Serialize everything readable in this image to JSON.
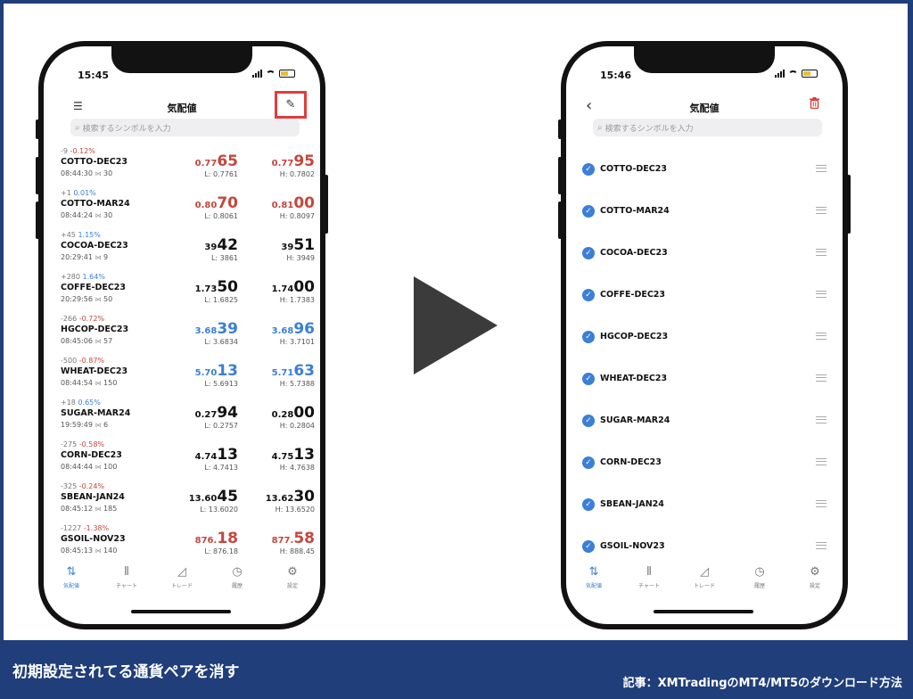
{
  "left_phone": {
    "status_time": "15:45",
    "title": "気配値",
    "search_placeholder": "検索するシンボルを入力",
    "quotes": [
      {
        "change_pts": "-9",
        "change_pct": "-0.12%",
        "dir": "down",
        "symbol": "COTTO-DEC23",
        "time": "08:44:30",
        "spread": "30",
        "bid_prefix": "0.77",
        "bid_big": "65",
        "ask_prefix": "0.77",
        "ask_big": "95",
        "bid_color": "red",
        "low": "L: 0.7761",
        "high": "H: 0.7802"
      },
      {
        "change_pts": "+1",
        "change_pct": "0.01%",
        "dir": "up",
        "symbol": "COTTO-MAR24",
        "time": "08:44:24",
        "spread": "30",
        "bid_prefix": "0.80",
        "bid_big": "70",
        "ask_prefix": "0.81",
        "ask_big": "00",
        "bid_color": "red",
        "low": "L: 0.8061",
        "high": "H: 0.8097"
      },
      {
        "change_pts": "+45",
        "change_pct": "1.15%",
        "dir": "up",
        "symbol": "COCOA-DEC23",
        "time": "20:29:41",
        "spread": "9",
        "bid_prefix": "39",
        "bid_big": "42",
        "ask_prefix": "39",
        "ask_big": "51",
        "bid_color": "blk",
        "low": "L: 3861",
        "high": "H: 3949"
      },
      {
        "change_pts": "+280",
        "change_pct": "1.64%",
        "dir": "up",
        "symbol": "COFFE-DEC23",
        "time": "20:29:56",
        "spread": "50",
        "bid_prefix": "1.73",
        "bid_big": "50",
        "ask_prefix": "1.74",
        "ask_big": "00",
        "bid_color": "blk",
        "low": "L: 1.6825",
        "high": "H: 1.7383"
      },
      {
        "change_pts": "-266",
        "change_pct": "-0.72%",
        "dir": "down",
        "symbol": "HGCOP-DEC23",
        "time": "08:45:06",
        "spread": "57",
        "bid_prefix": "3.68",
        "bid_big": "39",
        "ask_prefix": "3.68",
        "ask_big": "96",
        "bid_color": "blue",
        "low": "L: 3.6834",
        "high": "H: 3.7101"
      },
      {
        "change_pts": "-500",
        "change_pct": "-0.87%",
        "dir": "down",
        "symbol": "WHEAT-DEC23",
        "time": "08:44:54",
        "spread": "150",
        "bid_prefix": "5.70",
        "bid_big": "13",
        "ask_prefix": "5.71",
        "ask_big": "63",
        "bid_color": "blue",
        "low": "L: 5.6913",
        "high": "H: 5.7388"
      },
      {
        "change_pts": "+18",
        "change_pct": "0.65%",
        "dir": "up",
        "symbol": "SUGAR-MAR24",
        "time": "19:59:49",
        "spread": "6",
        "bid_prefix": "0.27",
        "bid_big": "94",
        "ask_prefix": "0.28",
        "ask_big": "00",
        "bid_color": "blk",
        "low": "L: 0.2757",
        "high": "H: 0.2804"
      },
      {
        "change_pts": "-275",
        "change_pct": "-0.58%",
        "dir": "down",
        "symbol": "CORN-DEC23",
        "time": "08:44:44",
        "spread": "100",
        "bid_prefix": "4.74",
        "bid_big": "13",
        "ask_prefix": "4.75",
        "ask_big": "13",
        "bid_color": "blk",
        "low": "L: 4.7413",
        "high": "H: 4.7638"
      },
      {
        "change_pts": "-325",
        "change_pct": "-0.24%",
        "dir": "down",
        "symbol": "SBEAN-JAN24",
        "time": "08:45:12",
        "spread": "185",
        "bid_prefix": "13.60",
        "bid_big": "45",
        "ask_prefix": "13.62",
        "ask_big": "30",
        "bid_color": "blk",
        "low": "L: 13.6020",
        "high": "H: 13.6520"
      },
      {
        "change_pts": "-1227",
        "change_pct": "-1.38%",
        "dir": "down",
        "symbol": "GSOIL-NOV23",
        "time": "08:45:13",
        "spread": "140",
        "bid_prefix": "876.",
        "bid_big": "18",
        "ask_prefix": "877.",
        "ask_big": "58",
        "bid_color": "red",
        "low": "L: 876.18",
        "high": "H: 888.45"
      }
    ]
  },
  "right_phone": {
    "status_time": "15:46",
    "title": "気配値",
    "search_placeholder": "検索するシンボルを入力",
    "symbols": [
      "COTTO-DEC23",
      "COTTO-MAR24",
      "COCOA-DEC23",
      "COFFE-DEC23",
      "HGCOP-DEC23",
      "WHEAT-DEC23",
      "SUGAR-MAR24",
      "CORN-DEC23",
      "SBEAN-JAN24",
      "GSOIL-NOV23"
    ]
  },
  "tabs": [
    {
      "label": "気配値",
      "icon": "swap-arrows-icon"
    },
    {
      "label": "チャート",
      "icon": "candlestick-icon"
    },
    {
      "label": "トレード",
      "icon": "trade-chart-icon"
    },
    {
      "label": "履歴",
      "icon": "history-icon"
    },
    {
      "label": "設定",
      "icon": "gear-icon"
    }
  ],
  "footer": {
    "caption": "初期設定されてる通貨ペアを消す",
    "article": "記事：XMTradingのMT4/MT5のダウンロード方法"
  },
  "colors": {
    "frame_blue": "#1f3e7a",
    "highlight_red": "#e23b3b",
    "accent_blue": "#3b7fd6",
    "price_red": "#c5463d"
  }
}
